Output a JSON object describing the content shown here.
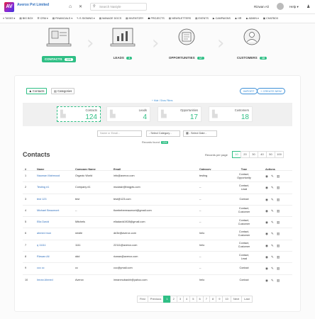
{
  "header": {
    "logo": "AV",
    "company": "Averox Pvt Limited",
    "home_icon": "home-icon",
    "search_placeholder": "Search Nastyle",
    "user_name": "Rizwan Ali",
    "help": "Help ▾"
  },
  "nav": [
    "≡ TASKS ▾",
    "▤ BIG BOX",
    "☰ CRM ▾",
    "▤ FINANCIALS ▾",
    "✎ E-SIGNING ▾",
    "▤ MANAGE DOCS",
    "▤ INVENTORY",
    "☗ PROJECTS",
    "▤ NEWSLETTERS",
    "▤ EVENTS",
    "▶ CAMPAIGNS",
    "♟ HR",
    "♟ ADMIN ▾",
    "▣ CHATBOX"
  ],
  "steps": [
    {
      "label": "CONTACTS",
      "count": "124"
    },
    {
      "label": "LEADS",
      "count": "4"
    },
    {
      "label": "OPPORTUNITIES",
      "count": "17"
    },
    {
      "label": "CUSTOMERS",
      "count": "18"
    }
  ],
  "tabs": {
    "contacts": "Contacts",
    "categories": "Categories"
  },
  "actions": {
    "import": "IMPORT",
    "create": "+ CREATE NEW"
  },
  "filters_link": "+ Hide / Show Filters",
  "summary": [
    {
      "title": "Contacts",
      "value": "124"
    },
    {
      "title": "Leads",
      "value": "4"
    },
    {
      "title": "Opportunities",
      "value": "17"
    },
    {
      "title": "Customers",
      "value": "18"
    }
  ],
  "filters": {
    "name_placeholder": "Name or Email...",
    "category": "- Select Category -",
    "date": "- Select Date -"
  },
  "records_found": {
    "label": "Records found:",
    "value": "124"
  },
  "title": "Contacts",
  "rpp": {
    "label": "Records per page",
    "options": [
      "10",
      "20",
      "30",
      "40",
      "50",
      "100"
    ]
  },
  "columns": {
    "num": "#",
    "name": "Name",
    "company": "Company Name",
    "email": "Email",
    "category": "Category",
    "type": "Type",
    "actions": "Actions"
  },
  "rows": [
    {
      "num": "1",
      "name": "Nauman Mahmood",
      "company": "Organic World",
      "email": "info@averox.com",
      "category": "testing",
      "type": [
        "Contact,",
        "Opportunity"
      ]
    },
    {
      "num": "2",
      "name": "Testing #1",
      "company": "Company #1",
      "email": "mudasir@bizgpts.com",
      "category": "--",
      "type": [
        "Contact,",
        "Lead"
      ]
    },
    {
      "num": "3",
      "name": "test 123",
      "company": "test",
      "email": "test@123.com",
      "category": "--",
      "type": [
        "Contact"
      ]
    },
    {
      "num": "4",
      "name": "Michael Beaumont",
      "company": "--",
      "email": "tlombebeeeaumont@gmail.com",
      "category": "--",
      "type": [
        "Contact,",
        "Customer"
      ]
    },
    {
      "num": "5",
      "name": "Ella David",
      "company": "Mitchels",
      "email": "elladavid1928@gmail.com",
      "category": "--",
      "type": [
        "Contact,",
        "Customer"
      ]
    },
    {
      "num": "6",
      "name": "ahmed mun",
      "company": "nestle",
      "email": "de3e@averox.com",
      "category": "helo",
      "type": [
        "Contact,",
        "Customer"
      ]
    },
    {
      "num": "7",
      "name": "q 11111",
      "company": "1111",
      "email": "22111@averox.com",
      "category": "helo",
      "type": [
        "Contact,",
        "Customer"
      ]
    },
    {
      "num": "8",
      "name": "Rizwan Ali",
      "company": "ddd",
      "email": "rizwan@averox.com",
      "category": "--",
      "type": [
        "Contact,",
        "Lead"
      ]
    },
    {
      "num": "9",
      "name": "ccc cc",
      "company": "cc",
      "email": "ccc@ymail.com",
      "category": "--",
      "type": [
        "Contact"
      ]
    },
    {
      "num": "10",
      "name": "Imran Ahmed",
      "company": "Averox",
      "email": "imranmubashir@yahoo.com",
      "category": "helo",
      "type": [
        "Contact"
      ]
    }
  ],
  "pager": [
    "First",
    "Previous",
    "1",
    "2",
    "3",
    "4",
    "5",
    "6",
    "7",
    "8",
    "9",
    "10",
    "Next",
    "Last"
  ]
}
